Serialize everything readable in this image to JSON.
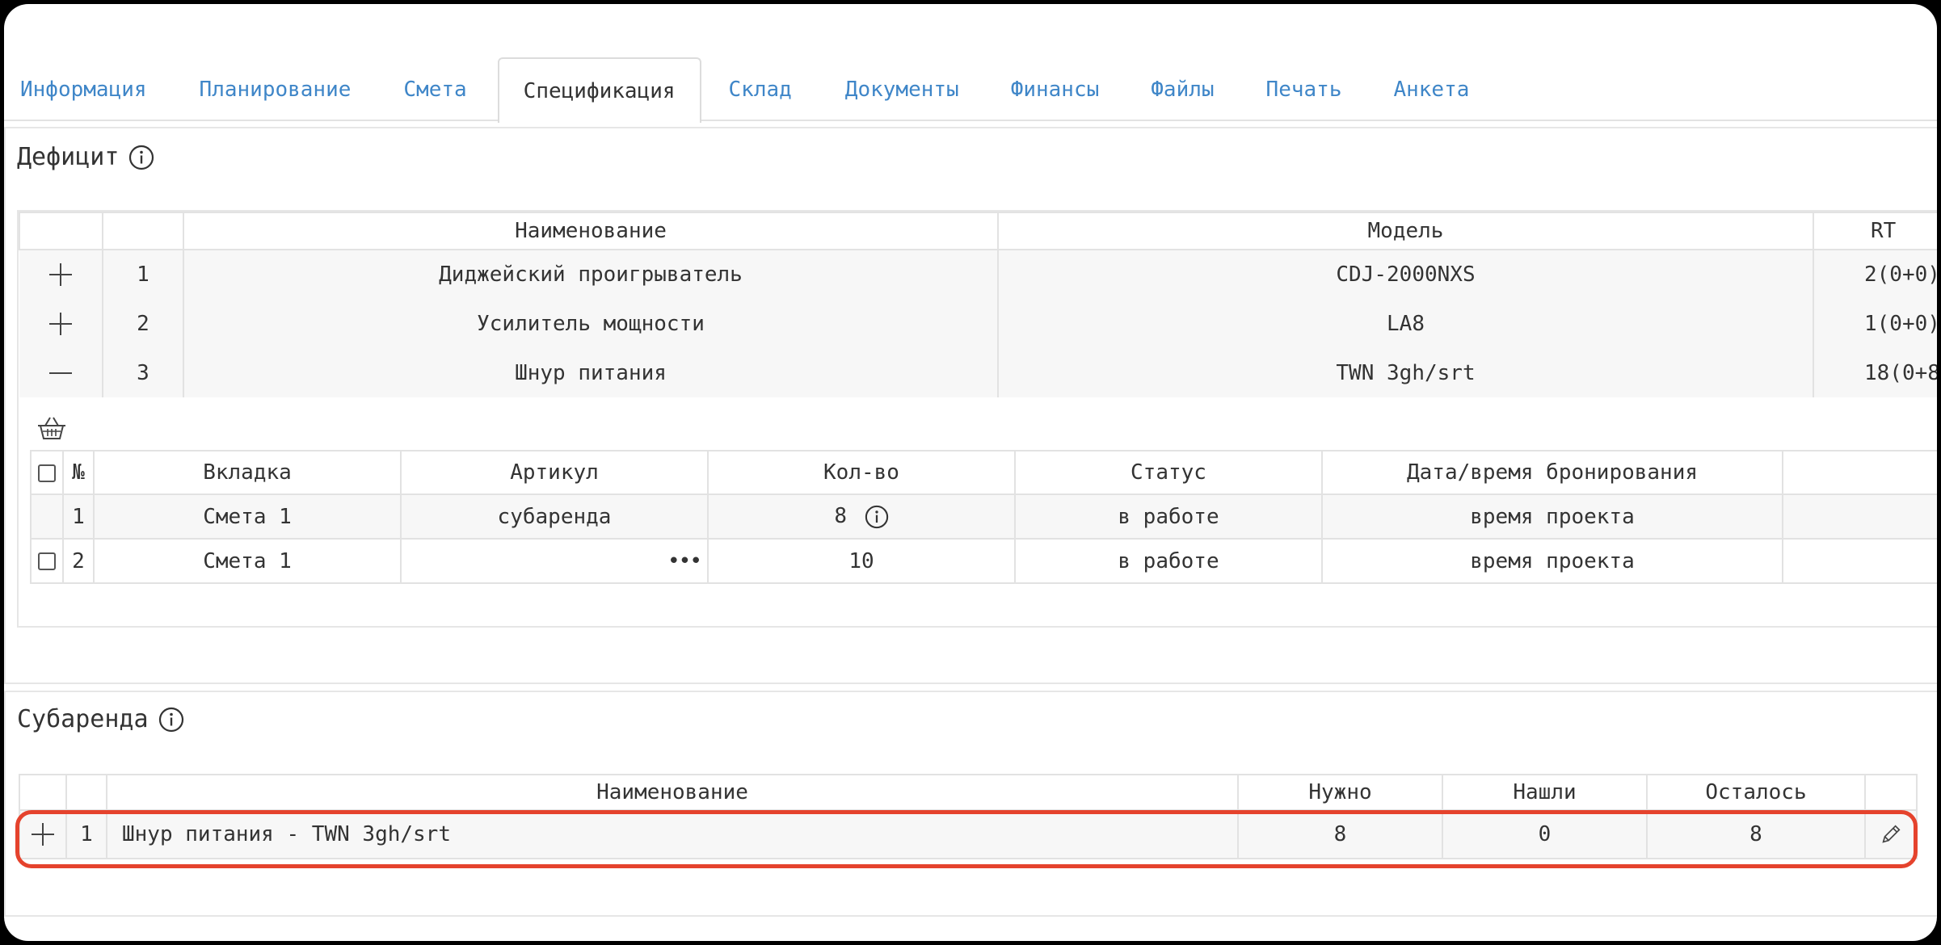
{
  "tabs": [
    {
      "label": "Информация"
    },
    {
      "label": "Планирование"
    },
    {
      "label": "Смета"
    },
    {
      "label": "Спецификация",
      "active": true
    },
    {
      "label": "Склад"
    },
    {
      "label": "Документы"
    },
    {
      "label": "Финансы"
    },
    {
      "label": "Файлы"
    },
    {
      "label": "Печать"
    },
    {
      "label": "Анкета"
    }
  ],
  "deficit": {
    "title": "Дефицит",
    "headers": {
      "name": "Наименование",
      "model": "Модель",
      "rt": "RT"
    },
    "rows": [
      {
        "num": "1",
        "name": "Диджейский проигрыватель",
        "model": "CDJ-2000NXS",
        "rt": "2(0+0)",
        "expand_icon": "plus-icon"
      },
      {
        "num": "2",
        "name": "Усилитель мощности",
        "model": "LA8",
        "rt": "1(0+0)",
        "expand_icon": "plus-icon"
      },
      {
        "num": "3",
        "name": "Шнур питания",
        "model": "TWN 3gh/srt",
        "rt": "18(0+8",
        "expand_icon": "minus-icon"
      }
    ],
    "sub": {
      "basket_icon": "basket-icon",
      "headers": {
        "num": "№",
        "tab": "Вкладка",
        "article": "Артикул",
        "qty": "Кол-во",
        "status": "Статус",
        "date": "Дата/время бронирования"
      },
      "rows": [
        {
          "num": "1",
          "tab": "Смета 1",
          "article": "субаренда",
          "qty": "8",
          "status": "в работе",
          "date": "время проекта",
          "checkbox": false,
          "qty_info": true
        },
        {
          "num": "2",
          "tab": "Смета 1",
          "article": "",
          "qty": "10",
          "status": "в работе",
          "date": "время проекта",
          "checkbox": true,
          "article_menu": "•••"
        }
      ]
    }
  },
  "subrent": {
    "title": "Субаренда",
    "headers": {
      "name": "Наименование",
      "need": "Нужно",
      "found": "Нашли",
      "left": "Осталось"
    },
    "rows": [
      {
        "num": "1",
        "name": "Шнур питания - TWN 3gh/srt",
        "need": "8",
        "found": "0",
        "left": "8"
      }
    ]
  },
  "colors": {
    "tab_link": "#3f86c8",
    "highlight": "#e5432d",
    "border": "#e2e2e2"
  }
}
